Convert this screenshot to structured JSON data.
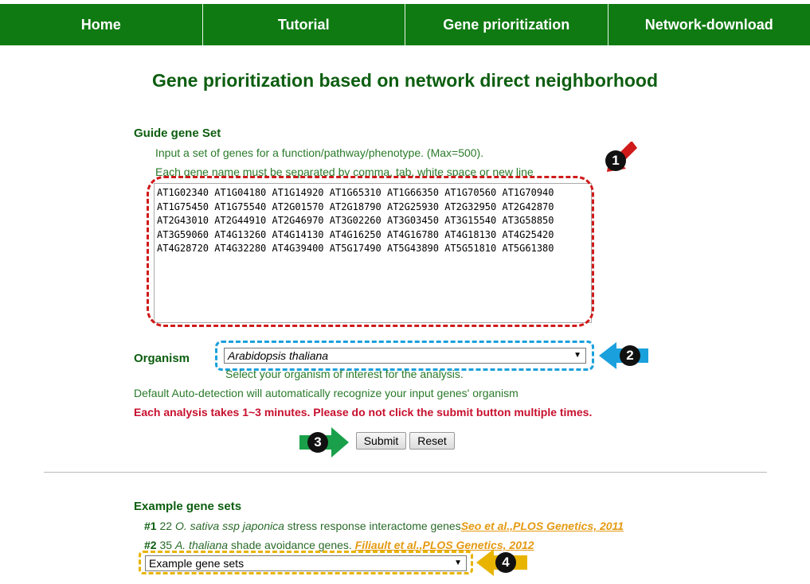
{
  "nav": {
    "items": [
      "Home",
      "Tutorial",
      "Gene prioritization",
      "Network-download"
    ]
  },
  "page_title": "Gene prioritization based on network direct neighborhood",
  "guide_set": {
    "heading": "Guide gene Set",
    "instruction1": "Input a set of genes for a function/pathway/phenotype. (Max=500).",
    "instruction2": "Each gene name must be separated by comma, tab, white space or new line",
    "genes_value": "AT1G02340 AT1G04180 AT1G14920 AT1G65310 AT1G66350 AT1G70560 AT1G70940\nAT1G75450 AT1G75540 AT2G01570 AT2G18790 AT2G25930 AT2G32950 AT2G42870\nAT2G43010 AT2G44910 AT2G46970 AT3G02260 AT3G03450 AT3G15540 AT3G58850\nAT3G59060 AT4G13260 AT4G14130 AT4G16250 AT4G16780 AT4G18130 AT4G25420\nAT4G28720 AT4G32280 AT4G39400 AT5G17490 AT5G43890 AT5G51810 AT5G61380"
  },
  "organism": {
    "label": "Organism",
    "selected": "Arabidopsis thaliana",
    "hint": "Select your organism of interest for the analysis.",
    "auto_detect_note": "Default Auto-detection will automatically recognize your input genes' organism"
  },
  "warning": "Each analysis takes 1~3 minutes. Please do not click the submit button multiple times.",
  "buttons": {
    "submit": "Submit",
    "reset": "Reset"
  },
  "examples": {
    "heading": "Example gene sets",
    "ex1": {
      "num": "#1",
      "count": "22",
      "species": "O. sativa ssp japonica",
      "desc": "stress response interactome genes",
      "cite": "Seo et al.,PLOS Genetics, 2011"
    },
    "ex2": {
      "num": "#2",
      "count": "35",
      "species": "A. thaliana",
      "desc": "shade avoidance genes.",
      "cite": "Filiault et al.,PLOS Genetics, 2012"
    },
    "select_value": "Example gene sets"
  },
  "annotations": {
    "b1": "1",
    "b2": "2",
    "b3": "3",
    "b4": "4"
  },
  "colors": {
    "nav_bg": "#0f7a12",
    "heading": "#0d5e10",
    "warning": "#c8102e",
    "citation": "#e49a12",
    "annot_red": "#d01a1a",
    "annot_blue": "#1aa0dc",
    "annot_green": "#1aa04a",
    "annot_gold": "#e8b400"
  }
}
